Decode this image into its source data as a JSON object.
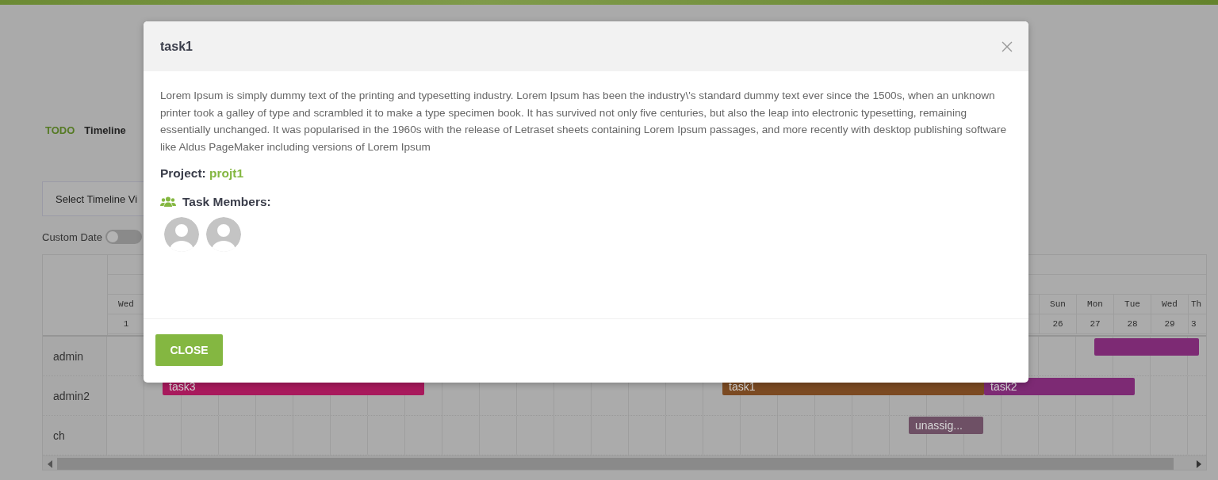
{
  "nav_tabs": [
    {
      "label": "TODO",
      "selected": false
    },
    {
      "label": "Timeline",
      "selected": true
    }
  ],
  "view_select": {
    "placeholder": "Select Timeline Vi"
  },
  "custom_date": {
    "label": "Custom Date",
    "on": false
  },
  "timeline": {
    "days_left": [
      {
        "weekday": "Wed",
        "date": "1"
      }
    ],
    "days_right": [
      {
        "weekday": "Sun",
        "date": "26"
      },
      {
        "weekday": "Mon",
        "date": "27"
      },
      {
        "weekday": "Tue",
        "date": "28"
      },
      {
        "weekday": "Wed",
        "date": "29"
      },
      {
        "weekday": "Th",
        "date": "3"
      }
    ],
    "rows": [
      {
        "name": "admin",
        "bars": [
          {
            "color": "#7d2a74"
          }
        ]
      },
      {
        "name": "admin2",
        "bars": [
          {
            "label": "task3",
            "color": "#a8195c"
          },
          {
            "label": "task1",
            "color": "#7b4a22"
          },
          {
            "label": "task2",
            "color": "#7d2a74"
          }
        ]
      },
      {
        "name": "ch",
        "bars": [
          {
            "label": "unassig...",
            "color": "#6e5065"
          }
        ]
      }
    ]
  },
  "modal": {
    "title": "task1",
    "description": "Lorem Ipsum is simply dummy text of the printing and typesetting industry. Lorem Ipsum has been the industry\\'s standard dummy text ever since the 1500s, when an unknown printer took a galley of type and scrambled it to make a type specimen book. It has survived not only five centuries, but also the leap into electronic typesetting, remaining essentially unchanged. It was popularised in the 1960s with the release of Letraset sheets containing Lorem Ipsum passages, and more recently with desktop publishing software like Aldus PageMaker including versions of Lorem Ipsum",
    "project_label": "Project:",
    "project": "projt1",
    "members_label": "Task Members:",
    "members": [
      {
        "kind": "avatar"
      },
      {
        "kind": "avatar"
      }
    ],
    "close_button": "CLOSE"
  }
}
